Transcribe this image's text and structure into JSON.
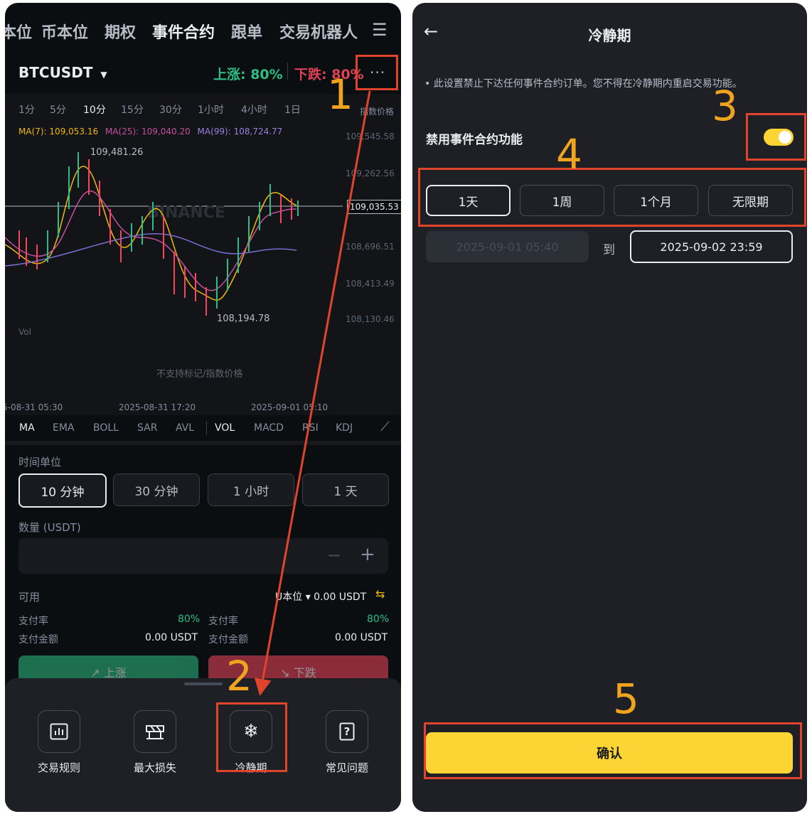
{
  "left": {
    "topnav": [
      "本位",
      "币本位",
      "期权",
      "事件合约",
      "跟单",
      "交易机器人"
    ],
    "menu_icon": "hamburger-icon",
    "pair": "BTCUSDT",
    "up_label": "上涨: 80%",
    "down_label": "下跌: 80%",
    "more_icon": "more-dots-icon",
    "intervals": [
      "1分",
      "5分",
      "10分",
      "15分",
      "30分",
      "1小时",
      "4小时",
      "1日"
    ],
    "index_price_label": "指数价格",
    "ma": {
      "ma7": "MA(7): 109,053.16",
      "ma25": "MA(25): 109,040.20",
      "ma99": "MA(99): 108,724.77"
    },
    "high_label": "109,481.26",
    "low_label": "108,194.78",
    "y_ticks": [
      "109,545.58",
      "109,262.56",
      "109,035.53",
      "108,696.51",
      "108,413.49",
      "108,130.46"
    ],
    "watermark": "BINANCE",
    "vol_label": "Vol",
    "no_support": "不支持标记/指数价格",
    "x_ticks": [
      "5-08-31 05:30",
      "2025-08-31 17:20",
      "2025-09-01 05:10"
    ],
    "indicators": [
      "MA",
      "EMA",
      "BOLL",
      "SAR",
      "AVL",
      "VOL",
      "MACD",
      "RSI",
      "KDJ"
    ],
    "time_unit_label": "时间单位",
    "time_units": [
      "10 分钟",
      "30 分钟",
      "1 小时",
      "1 天"
    ],
    "qty_label": "数量 (USDT)",
    "available_label": "可用",
    "available_value": "U本位 ▾ 0.00 USDT",
    "payout_rate_label": "支付率",
    "payout_rate_value": "80%",
    "payout_amount_label": "支付金额",
    "payout_amount_value": "0.00 USDT",
    "up_button": "↗ 上涨",
    "down_button": "↘ 下跌",
    "sheet": [
      {
        "label": "交易规则",
        "icon": "bar-chart-icon"
      },
      {
        "label": "最大损失",
        "icon": "barrier-icon"
      },
      {
        "label": "冷静期",
        "icon": "snowflake-icon"
      },
      {
        "label": "常见问题",
        "icon": "question-doc-icon"
      }
    ]
  },
  "right": {
    "title": "冷静期",
    "notice": "• 此设置禁止下达任何事件合约订单。您不得在冷静期内重启交易功能。",
    "toggle_label": "禁用事件合约功能",
    "toggle_on": true,
    "periods": [
      "1天",
      "1周",
      "1个月",
      "无限期"
    ],
    "selected_period": "1天",
    "start_date": "2025-09-01 05:40",
    "to_label": "到",
    "end_date": "2025-09-02 23:59",
    "confirm": "确认"
  },
  "annotations": [
    "1",
    "2",
    "3",
    "4",
    "5"
  ],
  "colors": {
    "up": "#2ebd85",
    "down": "#f6465d",
    "accent": "#fcd535",
    "annotation": "#f0a31c",
    "highlight": "#e0452b"
  }
}
